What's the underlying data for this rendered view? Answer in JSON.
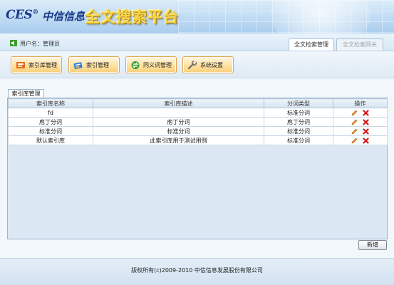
{
  "header": {
    "logo_ces": "CES",
    "logo_reg": "®",
    "logo_brand": "中信信息",
    "title": "全文搜索平台"
  },
  "userbar": {
    "user_label": "用户名：管理员",
    "tabs": [
      {
        "label": "全文检索管理",
        "active": true
      },
      {
        "label": "全文检索网关",
        "active": false
      }
    ]
  },
  "toolbar": {
    "buttons": [
      {
        "label": "索引库管理",
        "icon": "index-library-icon"
      },
      {
        "label": "索引管理",
        "icon": "index-icon"
      },
      {
        "label": "同义词管理",
        "icon": "synonym-icon"
      },
      {
        "label": "系统设置",
        "icon": "wrench-icon"
      }
    ]
  },
  "panel": {
    "tab_label": "索引库管理",
    "columns": [
      "索引库名称",
      "索引库描述",
      "分词类型",
      "操作"
    ],
    "rows": [
      [
        "fd",
        "",
        "标准分词"
      ],
      [
        "庖丁分词",
        "庖丁分词",
        "庖丁分词"
      ],
      [
        "标准分词",
        "标准分词",
        "标准分词"
      ],
      [
        "默认索引库",
        "此索引库用于测试用例",
        "标准分词"
      ]
    ],
    "add_label": "新增"
  },
  "footer": {
    "copyright": "版权所有(c)2009-2010 中信信息发展股份有限公司"
  },
  "colors": {
    "button_border": "#e0a64e",
    "button_fill": "#ffe3a6",
    "panel_bg": "#dbe7f3",
    "delete_red": "#d81818",
    "edit_orange": "#e07a20"
  }
}
